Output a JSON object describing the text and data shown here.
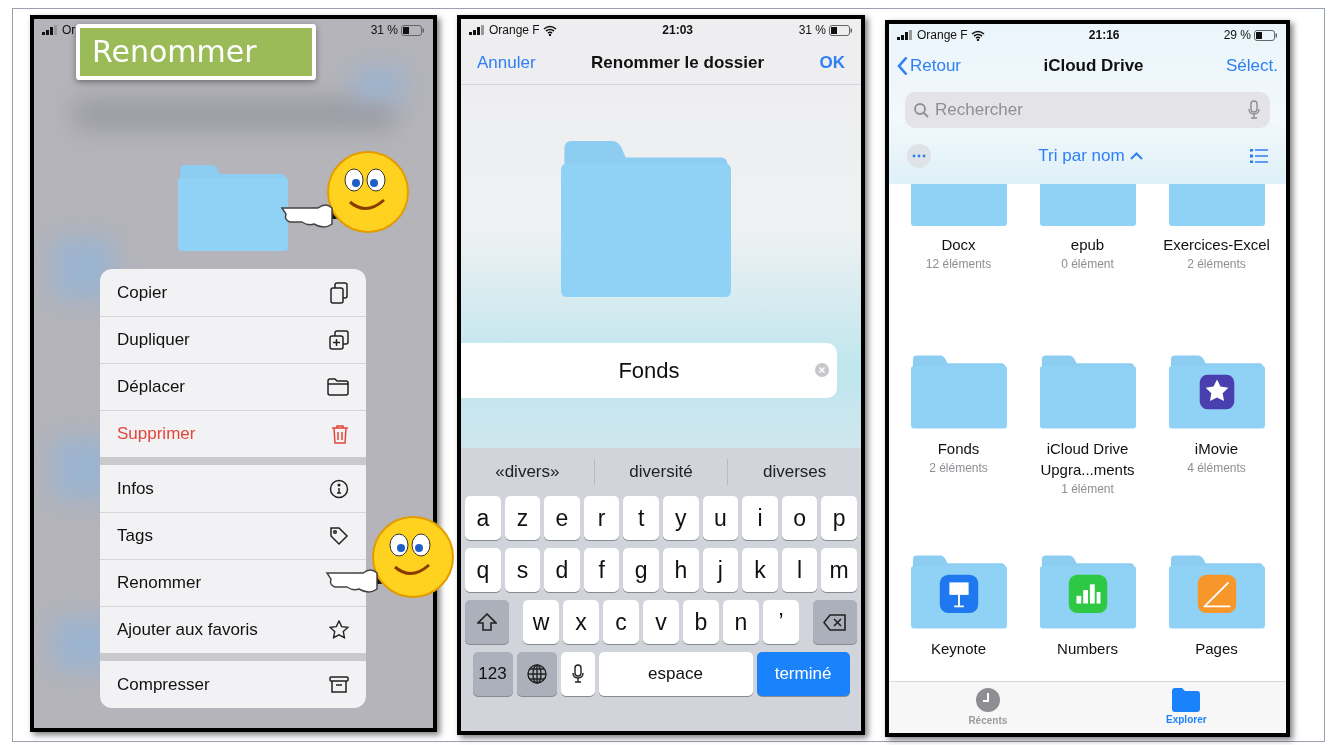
{
  "caption_label": "Renommer",
  "context_screen": {
    "status_bar": {
      "carrier": "Or",
      "battery": "31 %"
    },
    "menu_groups": [
      [
        {
          "label": "Copier",
          "destructive": false
        },
        {
          "label": "Dupliquer",
          "destructive": false
        },
        {
          "label": "Déplacer",
          "destructive": false
        },
        {
          "label": "Supprimer",
          "destructive": true
        }
      ],
      [
        {
          "label": "Infos",
          "destructive": false
        },
        {
          "label": "Tags",
          "destructive": false
        },
        {
          "label": "Renommer",
          "destructive": false
        },
        {
          "label": "Ajouter aux favoris",
          "destructive": false
        }
      ],
      [
        {
          "label": "Compresser",
          "destructive": false
        }
      ]
    ]
  },
  "rename_screen": {
    "status_bar": {
      "carrier": "Orange F",
      "time": "21:03",
      "battery": "31 %"
    },
    "cancel": "Annuler",
    "title": "Renommer le dossier",
    "ok": "OK",
    "name_field": {
      "value": "Fonds"
    },
    "suggestions": [
      "«divers»",
      "diversité",
      "diverses"
    ],
    "keyboard_rows": [
      [
        {
          "kind": "letter",
          "label": "a"
        },
        {
          "kind": "letter",
          "label": "z"
        },
        {
          "kind": "letter",
          "label": "e"
        },
        {
          "kind": "letter",
          "label": "r"
        },
        {
          "kind": "letter",
          "label": "t"
        },
        {
          "kind": "letter",
          "label": "y"
        },
        {
          "kind": "letter",
          "label": "u"
        },
        {
          "kind": "letter",
          "label": "i"
        },
        {
          "kind": "letter",
          "label": "o"
        },
        {
          "kind": "letter",
          "label": "p"
        }
      ],
      [
        {
          "kind": "letter",
          "label": "q"
        },
        {
          "kind": "letter",
          "label": "s"
        },
        {
          "kind": "letter",
          "label": "d"
        },
        {
          "kind": "letter",
          "label": "f"
        },
        {
          "kind": "letter",
          "label": "g"
        },
        {
          "kind": "letter",
          "label": "h"
        },
        {
          "kind": "letter",
          "label": "j"
        },
        {
          "kind": "letter",
          "label": "k"
        },
        {
          "kind": "letter",
          "label": "l"
        },
        {
          "kind": "letter",
          "label": "m"
        }
      ],
      [
        {
          "kind": "shift"
        },
        {
          "kind": "letter",
          "label": "w"
        },
        {
          "kind": "letter",
          "label": "x"
        },
        {
          "kind": "letter",
          "label": "c"
        },
        {
          "kind": "letter",
          "label": "v"
        },
        {
          "kind": "letter",
          "label": "b"
        },
        {
          "kind": "letter",
          "label": "n"
        },
        {
          "kind": "letter",
          "label": "’"
        },
        {
          "kind": "delete"
        }
      ],
      [
        {
          "kind": "numbers",
          "label": "123"
        },
        {
          "kind": "globe"
        },
        {
          "kind": "mic"
        },
        {
          "kind": "space",
          "label": "espace"
        },
        {
          "kind": "done",
          "label": "terminé"
        }
      ]
    ]
  },
  "drive_screen": {
    "status_bar": {
      "carrier": "Orange F",
      "time": "21:16",
      "battery": "29 %"
    },
    "back": "Retour",
    "title": "iCloud Drive",
    "select": "Sélect.",
    "search": {
      "placeholder": "Rechercher"
    },
    "sort": "Tri par nom",
    "items": [
      {
        "kind": "folder",
        "name": "Docx",
        "count": "12 éléments"
      },
      {
        "kind": "folder",
        "name": "epub",
        "count": "0 élément"
      },
      {
        "kind": "folder",
        "name": "Exercices-Excel",
        "count": "2 éléments"
      },
      {
        "kind": "folder",
        "name": "Fonds",
        "count": "2 éléments"
      },
      {
        "kind": "folder",
        "name": "iCloud Drive Upgra...ments",
        "count": "1 élément"
      },
      {
        "kind": "imovie",
        "name": "iMovie",
        "count": "4 éléments"
      },
      {
        "kind": "keynote",
        "name": "Keynote"
      },
      {
        "kind": "numbers",
        "name": "Numbers"
      },
      {
        "kind": "pages",
        "name": "Pages"
      }
    ],
    "tabs": [
      {
        "label": "Récents",
        "selected": false
      },
      {
        "label": "Explorer",
        "selected": true
      }
    ]
  }
}
